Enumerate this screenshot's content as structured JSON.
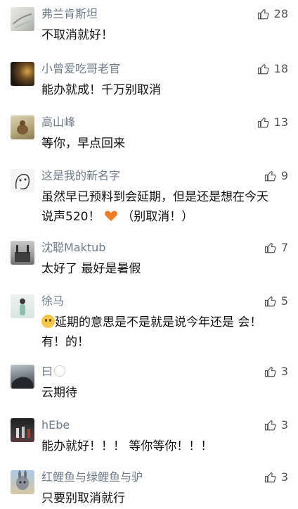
{
  "comments": [
    {
      "name": "弗兰肯斯坦",
      "likes": "28",
      "text": "不取消就好！"
    },
    {
      "name": "小曾爱吃哥老官",
      "likes": "18",
      "text": "能办就成！千万别取消"
    },
    {
      "name": "高山峰",
      "likes": "13",
      "text": "等你，早点回来"
    },
    {
      "name": "这是我的新名字",
      "likes": "9",
      "text_line1": "虽然早已预料到会延期，但是还是想在今天",
      "text_line2_a": "说声520！",
      "text_line2_b": "（别取消！）"
    },
    {
      "name": "沈聪Maktub",
      "likes": "7",
      "text": "太好了 最好是暑假"
    },
    {
      "name": "徐马",
      "likes": "5",
      "text_line1": "延期的意思是不是就是说今年还是 会！",
      "text_line2": "有！的！"
    },
    {
      "name": "曰",
      "likes": "3",
      "text": "云期待"
    },
    {
      "name": "hEbe",
      "likes": "3",
      "text": "能办就好！！！ 等你等你！！！"
    },
    {
      "name": "红鲤鱼与绿鲤鱼与驴",
      "likes": "3",
      "text": "只要别取消就行"
    }
  ],
  "icons": {
    "like": "thumbs-up-outline-icon",
    "heart": "orange-heart-emoji",
    "face": "face-emoji"
  },
  "colors": {
    "name": "#6f7b8b",
    "text": "#111111",
    "likes": "#555555",
    "heart": "#f07c2a"
  }
}
